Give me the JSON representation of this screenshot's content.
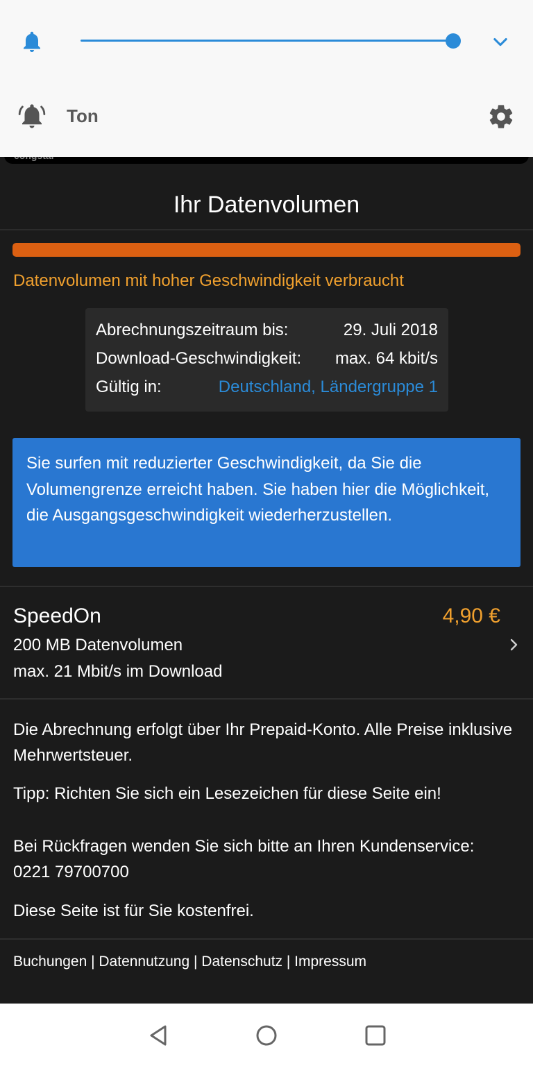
{
  "volume_panel": {
    "level": 1.0,
    "ringer_label": "Ton",
    "accent_color": "#2b8bd8"
  },
  "peek_text": "congstar",
  "page": {
    "title": "Ihr Datenvolumen",
    "usage_fraction": 1.0,
    "usage_color": "#dc6012",
    "status_text": "Datenvolumen mit hoher Geschwindigkeit verbraucht",
    "info": {
      "period_label": "Abrechnungszeitraum bis:",
      "period_value": "29. Juli 2018",
      "speed_label": "Download-Geschwindigkeit:",
      "speed_value": "max. 64 kbit/s",
      "valid_label": "Gültig in:",
      "valid_value": "Deutschland, Ländergruppe 1"
    },
    "notice": "Sie surfen mit reduzierter Geschwindigkeit, da Sie die Volumengrenze erreicht haben. Sie haben hier die Möglichkeit, die Ausgangsgeschwindigkeit wiederherzustellen.",
    "offer": {
      "name": "SpeedOn",
      "price": "4,90 €",
      "line1": "200 MB Datenvolumen",
      "line2": "max. 21 Mbit/s im Download"
    },
    "billing_note": "Die Abrechnung erfolgt über Ihr Prepaid-Konto. Alle Preise inklusive Mehrwertsteuer.",
    "tip": "Tipp: Richten Sie sich ein Lesezeichen für diese Seite ein!",
    "contact": "Bei Rückfragen wenden Sie sich bitte an Ihren Kundenservice: 0221 79700700",
    "free_note": "Diese Seite ist für Sie kostenfrei.",
    "footer": {
      "bookings": "Buchungen",
      "data_usage": "Datennutzung",
      "privacy": "Datenschutz",
      "imprint": "Impressum",
      "separator": " | "
    }
  }
}
